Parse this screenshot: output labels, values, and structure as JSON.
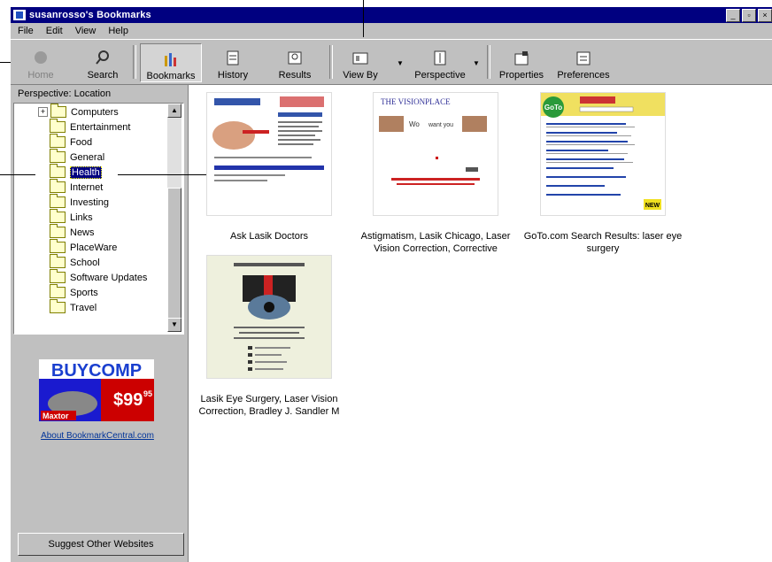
{
  "window": {
    "title": "susanrosso's Bookmarks",
    "controls": [
      "_",
      "▫",
      "×"
    ]
  },
  "menu": [
    "File",
    "Edit",
    "View",
    "Help"
  ],
  "toolbar": {
    "buttons": [
      {
        "label": "Home",
        "icon": "home-icon",
        "state": "disabled"
      },
      {
        "label": "Search",
        "icon": "search-icon",
        "state": "normal"
      },
      {
        "label": "Bookmarks",
        "icon": "bookmarks-icon",
        "state": "active"
      },
      {
        "label": "History",
        "icon": "history-icon",
        "state": "normal"
      },
      {
        "label": "Results",
        "icon": "results-icon",
        "state": "normal"
      },
      {
        "label": "View By",
        "icon": "view-by-icon",
        "state": "normal"
      },
      {
        "label": "Perspective",
        "icon": "perspective-icon",
        "state": "normal"
      },
      {
        "label": "Properties",
        "icon": "properties-icon",
        "state": "normal"
      },
      {
        "label": "Preferences",
        "icon": "preferences-icon",
        "state": "normal"
      }
    ]
  },
  "sidebar": {
    "perspective_label": "Perspective: Location",
    "tree": [
      {
        "label": "Computers",
        "expandable": true,
        "selected": false
      },
      {
        "label": "Entertainment",
        "expandable": false,
        "selected": false
      },
      {
        "label": "Food",
        "expandable": false,
        "selected": false
      },
      {
        "label": "General",
        "expandable": false,
        "selected": false
      },
      {
        "label": "Health",
        "expandable": false,
        "selected": true
      },
      {
        "label": "Internet",
        "expandable": false,
        "selected": false
      },
      {
        "label": "Investing",
        "expandable": false,
        "selected": false
      },
      {
        "label": "Links",
        "expandable": false,
        "selected": false
      },
      {
        "label": "News",
        "expandable": false,
        "selected": false
      },
      {
        "label": "PlaceWare",
        "expandable": false,
        "selected": false
      },
      {
        "label": "School",
        "expandable": false,
        "selected": false
      },
      {
        "label": "Software Updates",
        "expandable": false,
        "selected": false
      },
      {
        "label": "Sports",
        "expandable": false,
        "selected": false
      },
      {
        "label": "Travel",
        "expandable": false,
        "selected": false
      }
    ],
    "ad": {
      "brand": "BUYCOMP",
      "price": "$99",
      "cents": "95",
      "maker": "Maxtor"
    },
    "about_link": "About BookmarkCentral.com",
    "suggest_button": "Suggest Other Websites"
  },
  "bookmarks": [
    {
      "title": "Ask Lasik Doctors"
    },
    {
      "title": "Astigmatism, Lasik Chicago, Laser Vision Correction, Corrective"
    },
    {
      "title": "GoTo.com Search Results: laser eye surgery",
      "thumb_text": "GoTo",
      "thumb_badge": "NEW"
    },
    {
      "title": "Lasik Eye Surgery, Laser Vision Correction, Bradley J. Sandler M"
    }
  ],
  "thumb_text": {
    "visionplace": "THE VISIONPLACE",
    "word": "Wo",
    "word2": "want you"
  },
  "colors": {
    "titlebar": "#000080",
    "face": "#c0c0c0",
    "selection": "#000080",
    "link": "#003399"
  }
}
